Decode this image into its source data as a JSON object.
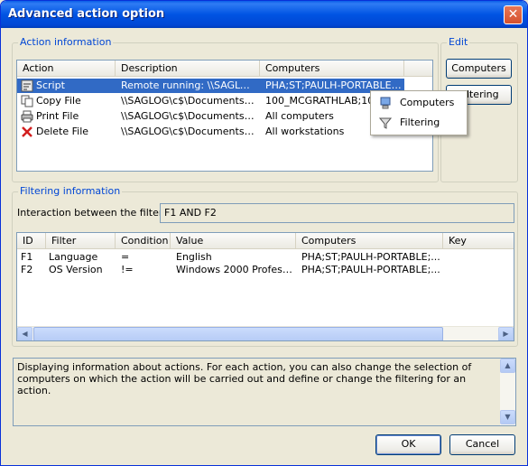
{
  "window": {
    "title": "Advanced action option",
    "close_glyph": "✕"
  },
  "action_group": {
    "label": "Action information",
    "columns": [
      "Action",
      "Description",
      "Computers"
    ],
    "rows": [
      {
        "action": "Script",
        "description": "Remote running: \\\\SAGLOG\\...",
        "computers": "PHA;ST;PAULH-PORTABLE;...",
        "icon": "script-icon"
      },
      {
        "action": "Copy File",
        "description": "\\\\SAGLOG\\c$\\Documents an...",
        "computers": "100_MCGRATHLAB;100_...",
        "icon": "copy-file-icon"
      },
      {
        "action": "Print File",
        "description": "\\\\SAGLOG\\c$\\Documents an...",
        "computers": "All computers",
        "icon": "printer-icon"
      },
      {
        "action": "Delete  File",
        "description": "\\\\SAGLOG\\c$\\Documents an...",
        "computers": "All workstations",
        "icon": "delete-icon"
      }
    ]
  },
  "edit_group": {
    "label": "Edit",
    "computers_button": "Computers",
    "filtering_button": "Filtering"
  },
  "context_menu": {
    "items": [
      {
        "label": "Computers",
        "icon": "computers-icon"
      },
      {
        "label": "Filtering",
        "icon": "filter-icon"
      }
    ]
  },
  "filter_group": {
    "label": "Filtering information",
    "interaction_label": "Interaction between the filters:",
    "interaction_value": "F1 AND F2",
    "columns": [
      "ID",
      "Filter",
      "Condition",
      "Value",
      "Computers",
      "Key"
    ],
    "rows": [
      {
        "id": "F1",
        "filter": "Language",
        "condition": "=",
        "value": "English",
        "computers": "PHA;ST;PAULH-PORTABLE;...",
        "key": ""
      },
      {
        "id": "F2",
        "filter": "OS Version",
        "condition": "!=",
        "value": "Windows 2000 Professi...",
        "computers": "PHA;ST;PAULH-PORTABLE;...",
        "key": ""
      }
    ]
  },
  "info_text": "Displaying information about actions. For each action, you can also change the selection of computers on which the action will be carried out and define or change the filtering for an action.",
  "buttons": {
    "ok": "OK",
    "cancel": "Cancel"
  },
  "colors": {
    "title_bar": "#0054e3",
    "selection": "#316ac5",
    "group_label": "#0046d5"
  }
}
